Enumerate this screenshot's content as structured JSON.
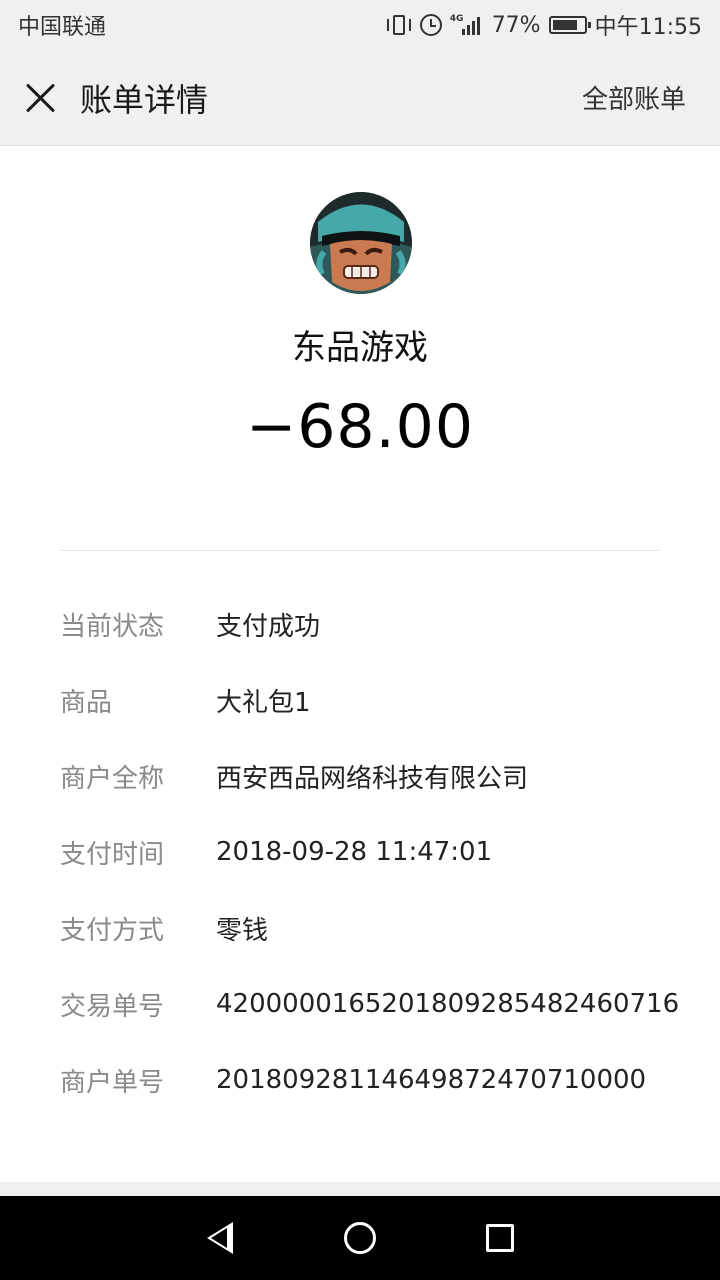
{
  "status_bar": {
    "carrier": "中国联通",
    "network": "4G",
    "battery": "77%",
    "time": "中午11:55"
  },
  "header": {
    "title": "账单详情",
    "all_bills_label": "全部账单"
  },
  "merchant": {
    "name": "东品游戏",
    "amount": "−68.00"
  },
  "details": [
    {
      "label": "当前状态",
      "value": "支付成功"
    },
    {
      "label": "商品",
      "value": "大礼包1"
    },
    {
      "label": "商户全称",
      "value": "西安西品网络科技有限公司"
    },
    {
      "label": "支付时间",
      "value": "2018-09-28 11:47:01"
    },
    {
      "label": "支付方式",
      "value": "零钱"
    },
    {
      "label": "交易单号",
      "value": "4200000165201809285482460716"
    },
    {
      "label": "商户单号",
      "value": "20180928114649872470710000"
    }
  ]
}
